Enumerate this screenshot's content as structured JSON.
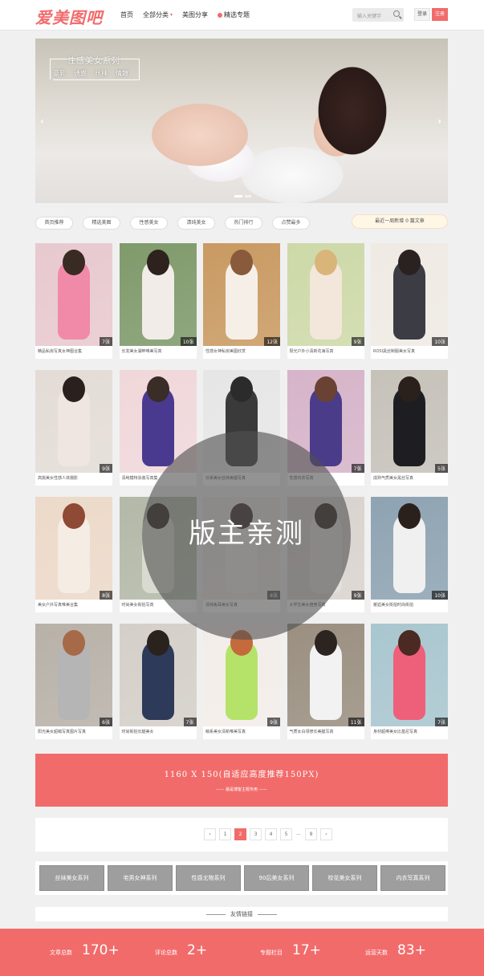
{
  "header": {
    "logo": "爱美图吧",
    "nav": [
      {
        "label": "首页"
      },
      {
        "label": "全部分类",
        "caret": "▾"
      },
      {
        "label": "美图分享"
      },
      {
        "label": "精选专题"
      }
    ],
    "search_placeholder": "输入关键字",
    "login_label": "登录",
    "register_label": "注册"
  },
  "banner": {
    "title": "性感美女系列",
    "tags": [
      "豪乳",
      "诱惑",
      "丝袜",
      "情趣"
    ],
    "prev_arrow": "‹",
    "next_arrow": "›"
  },
  "pills": [
    "首页推荐",
    "精选美图",
    "性感美女",
    "清纯美女",
    "热门排行",
    "点赞最多"
  ],
  "recent_label": "最近一周新增 0 篇文章",
  "cards": [
    {
      "caption": "精品私房写真女神图合集",
      "count": "7张",
      "bg": "#e7c9cf",
      "fig": "#f08aa8",
      "head": "#3a2a24"
    },
    {
      "caption": "长发美女湖畔唯美写真",
      "count": "10张",
      "bg": "#7f9a6b",
      "fig": "#f1ece8",
      "head": "#2d221e"
    },
    {
      "caption": "性感女神私房美图欣赏",
      "count": "12张",
      "bg": "#c99a62",
      "fig": "#f6efe8",
      "head": "#8a5a3c"
    },
    {
      "caption": "阳光户外小清新花海写真",
      "count": "9张",
      "bg": "#cdd9a8",
      "fig": "#f3e6da",
      "head": "#d9b57a"
    },
    {
      "caption": "ROSI黑丝制服美女写真",
      "count": "10张",
      "bg": "#efeae3",
      "fig": "#3c3c44",
      "head": "#2a2220"
    },
    {
      "caption": "高挑美女性感人体摄影",
      "count": "9张",
      "bg": "#e3dcd6",
      "fig": "#efe6e2",
      "head": "#2a201d"
    },
    {
      "caption": "清纯模特泳装写真集",
      "count": "",
      "bg": "#f0d7da",
      "fig": "#4a3a8f",
      "head": "#3a2c26"
    },
    {
      "caption": "日系美女丝袜美腿写真",
      "count": "",
      "bg": "#e6e6e6",
      "fig": "#3a3a3a",
      "head": "#2b2b2b"
    },
    {
      "caption": "性感内衣写真",
      "count": "7张",
      "bg": "#d6b4c9",
      "fig": "#4b3c8a",
      "head": "#6a4234"
    },
    {
      "caption": "成熟气质美女黑丝写真",
      "count": "5张",
      "bg": "#c6c2ba",
      "fig": "#1e1e22",
      "head": "#2a201c"
    },
    {
      "caption": "美女户外写真唯美合集",
      "count": "8张",
      "bg": "#ecd9c9",
      "fig": "#f5ece4",
      "head": "#8e4a34"
    },
    {
      "caption": "时尚美女街拍写真",
      "count": "",
      "bg": "#b3b9a8",
      "fig": "#dadbd0",
      "head": "#2a221e"
    },
    {
      "caption": "清纯兔耳美女写真",
      "count": "8张",
      "bg": "#ece6e1",
      "fig": "#f4eeea",
      "head": "#3a2b26"
    },
    {
      "caption": "大学生美女宿舍写真",
      "count": "9张",
      "bg": "#d9d3ce",
      "fig": "#e4e1dd",
      "head": "#2d231f"
    },
    {
      "caption": "邂逅美女街拍时尚街拍",
      "count": "10张",
      "bg": "#8ea3b2",
      "fig": "#f0f0f0",
      "head": "#2a211d"
    },
    {
      "caption": "阳光美女超萌写真图片写真",
      "count": "6张",
      "bg": "#b8b1a8",
      "fig": "#b5b5b5",
      "head": "#a66a48"
    },
    {
      "caption": "时尚街拍长腿美女",
      "count": "7张",
      "bg": "#d4cfc8",
      "fig": "#2d3a5a",
      "head": "#2a221d"
    },
    {
      "caption": "萌系美女清新唯美写真",
      "count": "9张",
      "bg": "#f3ede9",
      "fig": "#b5e36a",
      "head": "#c46a3c"
    },
    {
      "caption": "气质女白领修长美腿写真",
      "count": "11张",
      "bg": "#9a8f80",
      "fig": "#f2f2f2",
      "head": "#2c2420"
    },
    {
      "caption": "身材超棒美女比基尼写真",
      "count": "7张",
      "bg": "#a9c6cf",
      "fig": "#ee5f7a",
      "head": "#4a2a22"
    }
  ],
  "watermark": "版主亲测",
  "ad": {
    "line1": "1160 X 150(自适应高度推荐150PX)",
    "line2": "—— 最是博客主题专用 ——"
  },
  "pagination": [
    "‹",
    "1",
    "2",
    "3",
    "4",
    "5",
    "...",
    "9",
    "›"
  ],
  "pagination_active": "2",
  "series": [
    "丝袜美女系列",
    "宅男女神系列",
    "性感尤物系列",
    "90后美女系列",
    "校花美女系列",
    "内衣写真系列"
  ],
  "friends_label": "友情链接",
  "stats": [
    {
      "label": "文章总数",
      "value": "170+"
    },
    {
      "label": "评论总数",
      "value": "2+"
    },
    {
      "label": "专题栏目",
      "value": "17+"
    },
    {
      "label": "运营天数",
      "value": "83+"
    }
  ],
  "colors": {
    "accent": "#f26b6b"
  }
}
